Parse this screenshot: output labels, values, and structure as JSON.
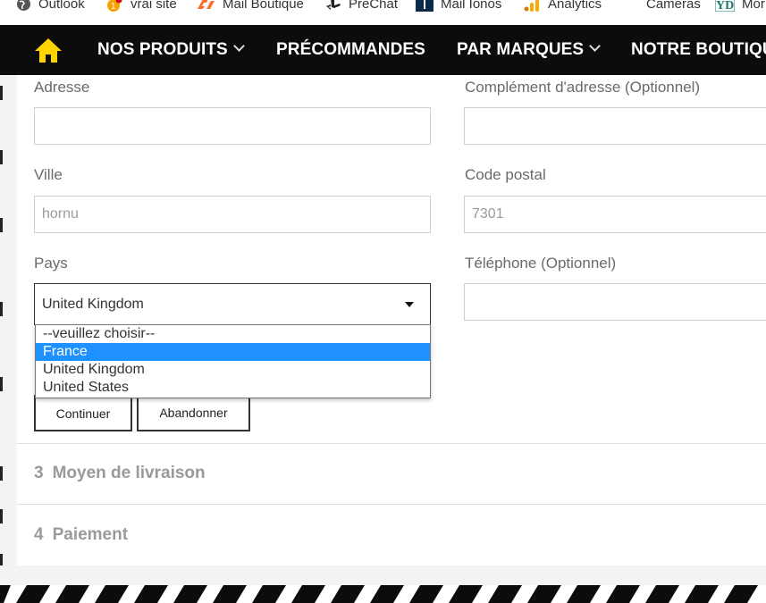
{
  "bookmarks": [
    {
      "label": "Outlook",
      "icon": "globe-icon",
      "color": "#555555"
    },
    {
      "label": "vrai site",
      "icon": "notification-badge-icon",
      "color": "#f4a300"
    },
    {
      "label": "Mail Boutique",
      "icon": "cpanel-icon",
      "color": "#ff6c2c"
    },
    {
      "label": "PreChat",
      "icon": "playstation-icon",
      "color": "#222222"
    },
    {
      "label": "Mail Ionos",
      "icon": "ionos-icon",
      "color": "#0b2a4a"
    },
    {
      "label": "Analytics",
      "icon": "analytics-icon",
      "color": "#f9ab00"
    },
    {
      "label": "Cameras",
      "icon": "",
      "color": ""
    },
    {
      "label": "Mor",
      "icon": "yd-icon",
      "color": "#1a7a6c"
    }
  ],
  "nav": {
    "home_icon": "home-icon",
    "home_color": "#ffd400",
    "items": [
      {
        "label": "NOS PRODUITS",
        "has_chevron": true
      },
      {
        "label": "PRÉCOMMANDES",
        "has_chevron": false
      },
      {
        "label": "PAR MARQUES",
        "has_chevron": true
      },
      {
        "label": "NOTRE BOUTIQUE",
        "has_chevron": false
      }
    ]
  },
  "form": {
    "address": {
      "label": "Adresse",
      "value": ""
    },
    "address2": {
      "label": "Complément d'adresse (Optionnel)",
      "value": ""
    },
    "city": {
      "label": "Ville",
      "placeholder": "hornu"
    },
    "postal": {
      "label": "Code postal",
      "placeholder": "7301"
    },
    "country": {
      "label": "Pays",
      "selected": "United Kingdom",
      "options": [
        "--veuillez choisir--",
        "France",
        "United Kingdom",
        "United States"
      ],
      "highlighted": "France"
    },
    "phone": {
      "label": "Téléphone (Optionnel)",
      "value": ""
    },
    "continue_label": "Continuer",
    "cancel_label": "Abandonner"
  },
  "steps": [
    {
      "number": "3",
      "label": "Moyen de livraison"
    },
    {
      "number": "4",
      "label": "Paiement"
    }
  ],
  "colors": {
    "nav_bg": "#0c0c0c",
    "highlight": "#1e90ff",
    "step_text": "#9a9a9a"
  }
}
